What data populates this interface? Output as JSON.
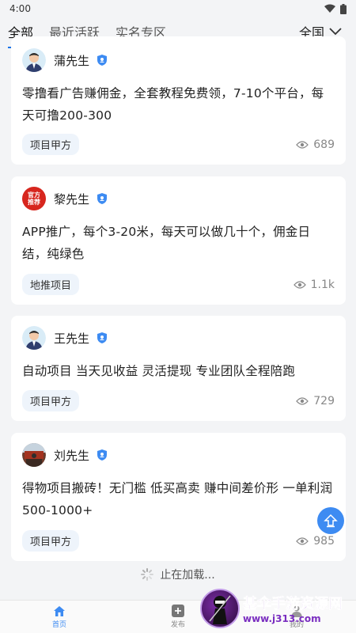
{
  "status": {
    "time": "4:00"
  },
  "tabs": [
    {
      "label": "全部",
      "active": true
    },
    {
      "label": "最近活跃",
      "active": false
    },
    {
      "label": "实名专区",
      "active": false
    }
  ],
  "region": {
    "label": "全国"
  },
  "cards": [
    {
      "name": "蒲先生",
      "content": "零撸看广告赚佣金，全套教程免费领，7-10个平台，每天可撸200-300",
      "tag": "项目甲方",
      "views": "689",
      "avatar": "person"
    },
    {
      "name": "黎先生",
      "content": "APP推广，每个3-20米，每天可以做几十个，佣金日结，纯绿色",
      "tag": "地推项目",
      "views": "1.1k",
      "avatar": "official",
      "avatar_text": "官方推荐"
    },
    {
      "name": "王先生",
      "content": "自动项目 当天见收益 灵活提现 专业团队全程陪跑",
      "tag": "项目甲方",
      "views": "729",
      "avatar": "person"
    },
    {
      "name": "刘先生",
      "content": "得物项目搬砖！无门槛 低买高卖 赚中间差价形 一单利润500-1000+",
      "tag": "项目甲方",
      "views": "985",
      "avatar": "photo"
    }
  ],
  "loading": {
    "text": "止在加载..."
  },
  "nav": [
    {
      "label": "首页",
      "active": true
    },
    {
      "label": "发布",
      "active": false
    },
    {
      "label": "我的",
      "active": false
    }
  ],
  "watermark": {
    "line1": "基伞手游资源网",
    "line2": "www.j313.com"
  },
  "colors": {
    "accent": "#3d8bf2",
    "tag_bg": "#eef4fb",
    "official_red": "#d7261e"
  }
}
